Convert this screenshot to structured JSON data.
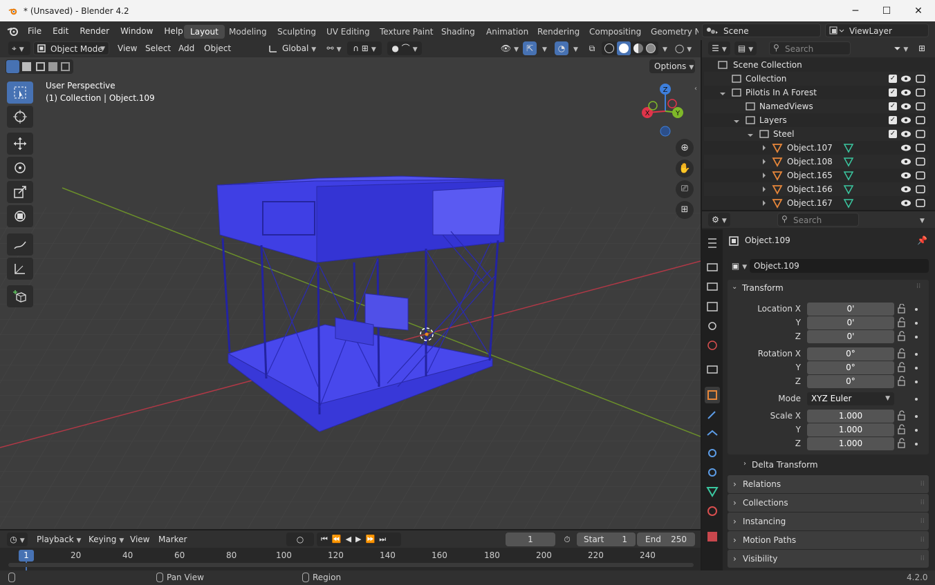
{
  "window": {
    "title": "* (Unsaved) - Blender 4.2",
    "minimize": "─",
    "maximize": "☐",
    "close": "✕"
  },
  "menu": [
    "File",
    "Edit",
    "Render",
    "Window",
    "Help"
  ],
  "workspaces": [
    "Layout",
    "Modeling",
    "Sculpting",
    "UV Editing",
    "Texture Paint",
    "Shading",
    "Animation",
    "Rendering",
    "Compositing",
    "Geometry No"
  ],
  "scene": {
    "name": "Scene",
    "view_layer": "ViewLayer"
  },
  "viewport_header": {
    "mode": "Object Mode",
    "view": "View",
    "select": "Select",
    "add": "Add",
    "object": "Object",
    "orientation": "Global",
    "options": "Options"
  },
  "viewport": {
    "perspective": "User Perspective",
    "info": "(1) Collection | Object.109",
    "gizmo": {
      "x": "X",
      "y": "Y",
      "z": "Z"
    }
  },
  "outliner": {
    "search_placeholder": "Search",
    "rows": [
      {
        "label": "Scene Collection"
      },
      {
        "label": "Collection"
      },
      {
        "label": "Pilotis In A Forest"
      },
      {
        "label": "NamedViews"
      },
      {
        "label": "Layers"
      },
      {
        "label": "Steel"
      },
      {
        "label": "Object.107"
      },
      {
        "label": "Object.108"
      },
      {
        "label": "Object.165"
      },
      {
        "label": "Object.166"
      },
      {
        "label": "Object.167"
      }
    ]
  },
  "properties": {
    "search_placeholder": "Search",
    "object_name": "Object.109",
    "object_field": "Object.109",
    "transform": {
      "title": "Transform",
      "location_label": "Location X",
      "rotation_label": "Rotation X",
      "scale_label": "Scale X",
      "y": "Y",
      "z": "Z",
      "location": [
        "0'",
        "0'",
        "0'"
      ],
      "rotation": [
        "0°",
        "0°",
        "0°"
      ],
      "mode_label": "Mode",
      "mode": "XYZ Euler",
      "scale": [
        "1.000",
        "1.000",
        "1.000"
      ]
    },
    "panels": [
      "Delta Transform",
      "Relations",
      "Collections",
      "Instancing",
      "Motion Paths",
      "Visibility"
    ]
  },
  "timeline": {
    "playback": "Playback",
    "keying": "Keying",
    "view": "View",
    "marker": "Marker",
    "current_frame": "1",
    "start_label": "Start",
    "start": "1",
    "end_label": "End",
    "end": "250",
    "ruler": [
      "1",
      "20",
      "40",
      "60",
      "80",
      "100",
      "120",
      "140",
      "160",
      "180",
      "200",
      "220",
      "240"
    ]
  },
  "status": {
    "pan": "Pan View",
    "region": "Region",
    "version": "4.2.0"
  },
  "colors": {
    "accent": "#4772b3",
    "model": "#3b3bdc",
    "x_axis": "#e0344a",
    "y_axis": "#7fb829",
    "z_axis": "#3d7fdc"
  }
}
